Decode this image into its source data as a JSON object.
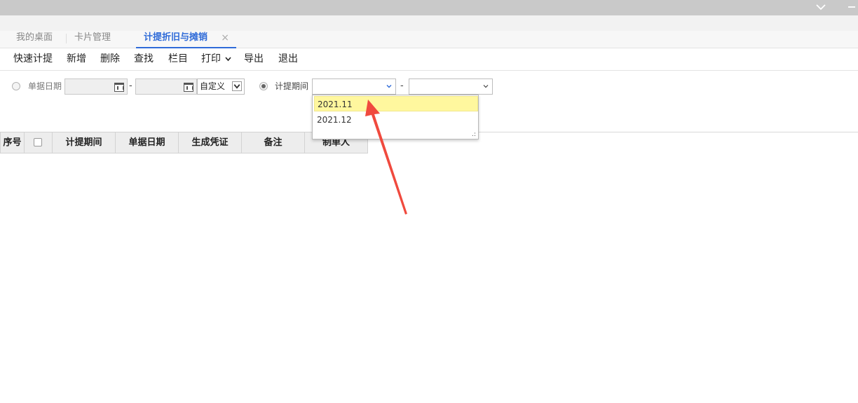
{
  "window": {
    "chevron_icon": "chevron-down-icon",
    "minimize_icon": "minus-icon"
  },
  "tabs": [
    {
      "label": "我的桌面",
      "active": false
    },
    {
      "label": "卡片管理",
      "active": false
    },
    {
      "label": "计提折旧与摊销",
      "active": true,
      "close": "×"
    }
  ],
  "toolbar": {
    "items": [
      "快速计提",
      "新增",
      "删除",
      "查找",
      "栏目",
      "打印",
      "导出",
      "退出"
    ]
  },
  "filter": {
    "doc_date_label": "单据日期",
    "date_from_value": "",
    "date_to_value": "",
    "date_separator": "-",
    "range_select_value": "自定义",
    "period_label": "计提期间",
    "period_from_value": "",
    "period_separator": "-",
    "period_to_value": "",
    "selected_radio": "period"
  },
  "dropdown": {
    "options": [
      "2021.11",
      "2021.12"
    ],
    "highlighted": "2021.11"
  },
  "table": {
    "columns": [
      "序号",
      "",
      "计提期间",
      "单据日期",
      "生成凭证",
      "备注",
      "制单人"
    ]
  },
  "colors": {
    "accent": "#2f6bd8",
    "highlight": "#fff79e",
    "arrow": "#f04a3e"
  }
}
